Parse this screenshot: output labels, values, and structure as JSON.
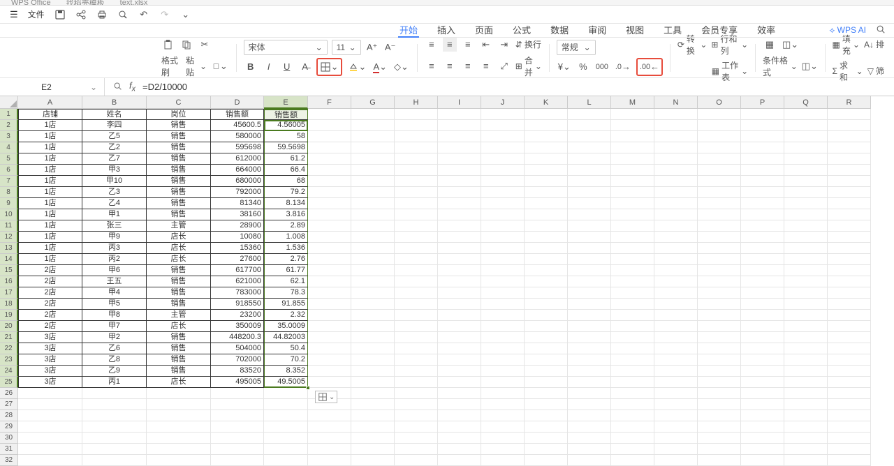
{
  "tabs": {
    "t1": "WPS Office",
    "t2": "找稻壳模板",
    "t3": "text.xlsx"
  },
  "quick": {
    "file": "文件"
  },
  "menu": {
    "items": [
      "开始",
      "插入",
      "页面",
      "公式",
      "数据",
      "审阅",
      "视图",
      "工具",
      "会员专享",
      "效率"
    ],
    "active_index": 0,
    "ai": "WPS AI"
  },
  "ribbon": {
    "format_painter": "格式刷",
    "paste": "粘贴",
    "font_name": "宋体",
    "font_size": "11",
    "wrap": "换行",
    "merge": "合并",
    "number_format": "常规",
    "convert": "转换",
    "rows_cols": "行和列",
    "worksheet": "工作表",
    "cond_format": "条件格式",
    "fill": "填充",
    "sum": "求和",
    "filter": "筛",
    "sort": "排"
  },
  "name_box": "E2",
  "formula": "=D2/10000",
  "columns": [
    "A",
    "B",
    "C",
    "D",
    "E",
    "F",
    "G",
    "H",
    "I",
    "J",
    "K",
    "L",
    "M",
    "N",
    "O",
    "P",
    "Q",
    "R"
  ],
  "col_widths": [
    "cw-A",
    "cw-B",
    "cw-C",
    "cw-D",
    "cw-E",
    "cw-std",
    "cw-std",
    "cw-std",
    "cw-std",
    "cw-std",
    "cw-std",
    "cw-std",
    "cw-std",
    "cw-std",
    "cw-std",
    "cw-std",
    "cw-std",
    "cw-std"
  ],
  "selected_col_index": 4,
  "headers": [
    "店铺",
    "姓名",
    "岗位",
    "销售额",
    "销售额"
  ],
  "rows": [
    {
      "a": "1店",
      "b": "李四",
      "c": "销售",
      "d": "45600.5",
      "e": "4.56005"
    },
    {
      "a": "1店",
      "b": "乙5",
      "c": "销售",
      "d": "580000",
      "e": "58"
    },
    {
      "a": "1店",
      "b": "乙2",
      "c": "销售",
      "d": "595698",
      "e": "59.5698"
    },
    {
      "a": "1店",
      "b": "乙7",
      "c": "销售",
      "d": "612000",
      "e": "61.2"
    },
    {
      "a": "1店",
      "b": "甲3",
      "c": "销售",
      "d": "664000",
      "e": "66.4"
    },
    {
      "a": "1店",
      "b": "甲10",
      "c": "销售",
      "d": "680000",
      "e": "68"
    },
    {
      "a": "1店",
      "b": "乙3",
      "c": "销售",
      "d": "792000",
      "e": "79.2"
    },
    {
      "a": "1店",
      "b": "乙4",
      "c": "销售",
      "d": "81340",
      "e": "8.134"
    },
    {
      "a": "1店",
      "b": "甲1",
      "c": "销售",
      "d": "38160",
      "e": "3.816"
    },
    {
      "a": "1店",
      "b": "张三",
      "c": "主管",
      "d": "28900",
      "e": "2.89"
    },
    {
      "a": "1店",
      "b": "甲9",
      "c": "店长",
      "d": "10080",
      "e": "1.008"
    },
    {
      "a": "1店",
      "b": "丙3",
      "c": "店长",
      "d": "15360",
      "e": "1.536"
    },
    {
      "a": "1店",
      "b": "丙2",
      "c": "店长",
      "d": "27600",
      "e": "2.76"
    },
    {
      "a": "2店",
      "b": "甲6",
      "c": "销售",
      "d": "617700",
      "e": "61.77"
    },
    {
      "a": "2店",
      "b": "王五",
      "c": "销售",
      "d": "621000",
      "e": "62.1"
    },
    {
      "a": "2店",
      "b": "甲4",
      "c": "销售",
      "d": "783000",
      "e": "78.3"
    },
    {
      "a": "2店",
      "b": "甲5",
      "c": "销售",
      "d": "918550",
      "e": "91.855"
    },
    {
      "a": "2店",
      "b": "甲8",
      "c": "主管",
      "d": "23200",
      "e": "2.32"
    },
    {
      "a": "2店",
      "b": "甲7",
      "c": "店长",
      "d": "350009",
      "e": "35.0009"
    },
    {
      "a": "3店",
      "b": "甲2",
      "c": "销售",
      "d": "448200.3",
      "e": "44.82003"
    },
    {
      "a": "3店",
      "b": "乙6",
      "c": "销售",
      "d": "504000",
      "e": "50.4"
    },
    {
      "a": "3店",
      "b": "乙8",
      "c": "销售",
      "d": "702000",
      "e": "70.2"
    },
    {
      "a": "3店",
      "b": "乙9",
      "c": "销售",
      "d": "83520",
      "e": "8.352"
    },
    {
      "a": "3店",
      "b": "丙1",
      "c": "店长",
      "d": "495005",
      "e": "49.5005"
    }
  ],
  "empty_rows": [
    26,
    27,
    28,
    29,
    30,
    31,
    32
  ]
}
